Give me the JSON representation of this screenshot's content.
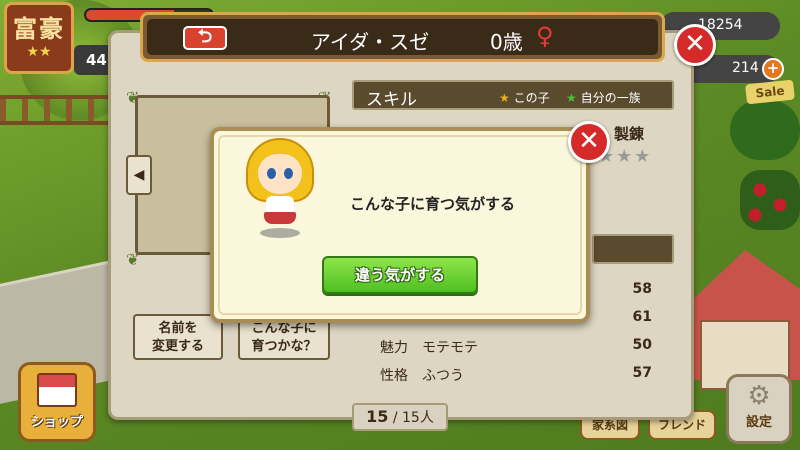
{
  "hud": {
    "rank_text": "富豪",
    "rank_stars": "★★",
    "level_value": "44",
    "money_value": "18254",
    "coins_value": "214",
    "plus_label": "+",
    "sale_label": "Sale"
  },
  "bottom_nav": {
    "shop_label": "ショップ",
    "family_label": "家系図",
    "friend_label": "フレンド",
    "settings_label": "設定"
  },
  "character": {
    "name": "アイダ・スゼ",
    "age": "0歳",
    "gender_symbol": "♀",
    "back_symbol": "⮌",
    "close_symbol": "✕"
  },
  "skill": {
    "title": "スキル",
    "legend_this_child": "この子",
    "legend_family": "自分の一族",
    "visible_skill_name": "製錬",
    "visible_skill_stars": "★★★"
  },
  "stats": [
    {
      "label": "",
      "value": "",
      "num": "58"
    },
    {
      "label": "",
      "value": "",
      "num": "61"
    },
    {
      "label": "魅力",
      "value": "モテモテ",
      "num": "50"
    },
    {
      "label": "性格",
      "value": "ふつう",
      "num": "57"
    }
  ],
  "buttons": {
    "rename_line1": "名前を",
    "rename_line2": "変更する",
    "grow_line1": "こんな子に",
    "grow_line2": "育つかな？"
  },
  "pager": {
    "current": "15",
    "total": "/ 15人"
  },
  "modal": {
    "message": "こんな子に育つ気がする",
    "action_label": "違う気がする",
    "close_symbol": "✕"
  },
  "colors": {
    "accent_red": "#d42a2a",
    "accent_green": "#4fbf22",
    "panel_bg": "#ddd6c2",
    "title_bar": "#3a2a18"
  }
}
